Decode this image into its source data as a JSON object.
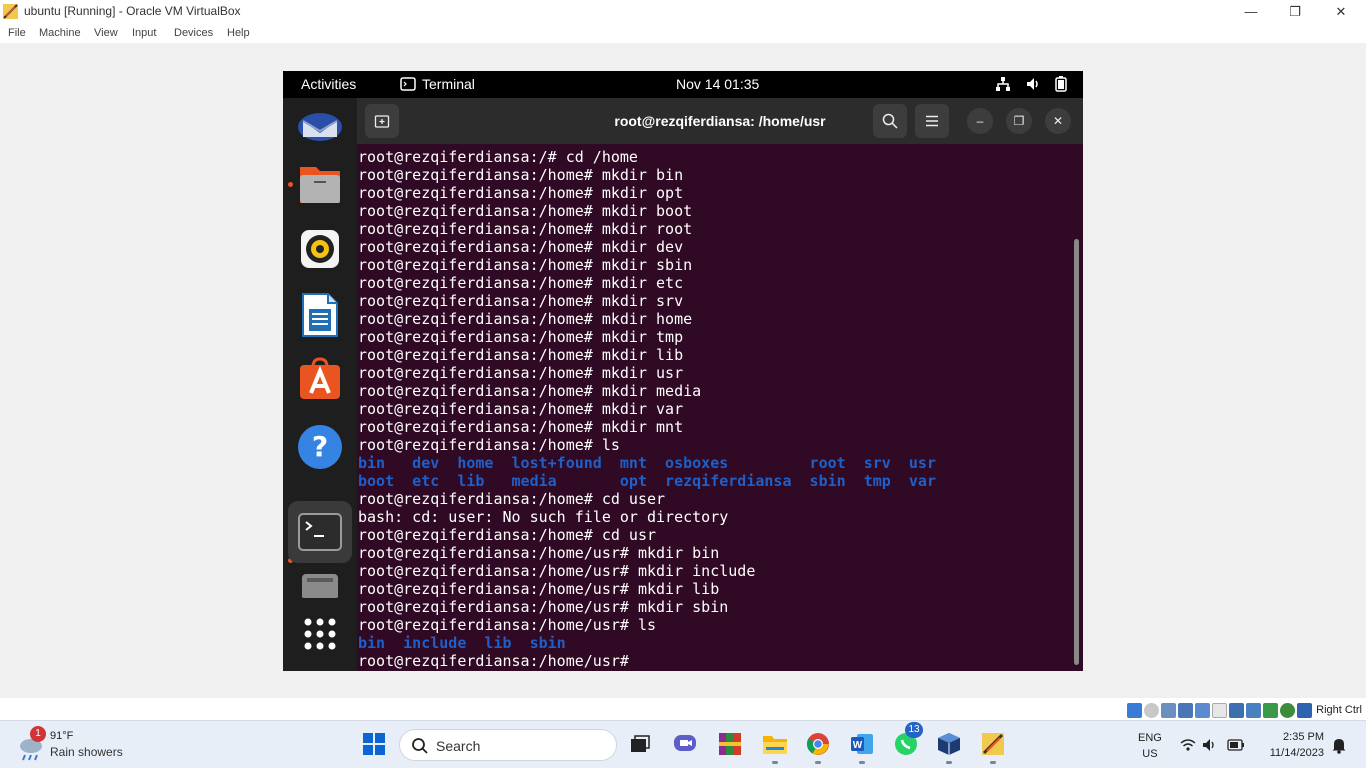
{
  "vbox": {
    "title": "ubuntu [Running] - Oracle VM VirtualBox",
    "menu": [
      "File",
      "Machine",
      "View",
      "Input",
      "Devices",
      "Help"
    ],
    "host_key": "Right Ctrl"
  },
  "gnome": {
    "activities": "Activities",
    "app_name": "Terminal",
    "clock": "Nov 14  01:35"
  },
  "terminal": {
    "title": "root@rezqiferdiansa: /home/usr",
    "lines": [
      {
        "text": "root@rezqiferdiansa:/# cd /home",
        "kind": "cmd"
      },
      {
        "text": "root@rezqiferdiansa:/home# mkdir bin",
        "kind": "cmd"
      },
      {
        "text": "root@rezqiferdiansa:/home# mkdir opt",
        "kind": "cmd"
      },
      {
        "text": "root@rezqiferdiansa:/home# mkdir boot",
        "kind": "cmd"
      },
      {
        "text": "root@rezqiferdiansa:/home# mkdir root",
        "kind": "cmd"
      },
      {
        "text": "root@rezqiferdiansa:/home# mkdir dev",
        "kind": "cmd"
      },
      {
        "text": "root@rezqiferdiansa:/home# mkdir sbin",
        "kind": "cmd"
      },
      {
        "text": "root@rezqiferdiansa:/home# mkdir etc",
        "kind": "cmd"
      },
      {
        "text": "root@rezqiferdiansa:/home# mkdir srv",
        "kind": "cmd"
      },
      {
        "text": "root@rezqiferdiansa:/home# mkdir home",
        "kind": "cmd"
      },
      {
        "text": "root@rezqiferdiansa:/home# mkdir tmp",
        "kind": "cmd"
      },
      {
        "text": "root@rezqiferdiansa:/home# mkdir lib",
        "kind": "cmd"
      },
      {
        "text": "root@rezqiferdiansa:/home# mkdir usr",
        "kind": "cmd"
      },
      {
        "text": "root@rezqiferdiansa:/home# mkdir media",
        "kind": "cmd"
      },
      {
        "text": "root@rezqiferdiansa:/home# mkdir var",
        "kind": "cmd"
      },
      {
        "text": "root@rezqiferdiansa:/home# mkdir mnt",
        "kind": "cmd"
      },
      {
        "text": "root@rezqiferdiansa:/home# ls",
        "kind": "cmd"
      },
      {
        "text": "bin   dev  home  lost+found  mnt  osboxes         root  srv  usr",
        "kind": "ls"
      },
      {
        "text": "boot  etc  lib   media       opt  rezqiferdiansa  sbin  tmp  var",
        "kind": "ls"
      },
      {
        "text": "root@rezqiferdiansa:/home# cd user",
        "kind": "cmd"
      },
      {
        "text": "bash: cd: user: No such file or directory",
        "kind": "out"
      },
      {
        "text": "root@rezqiferdiansa:/home# cd usr",
        "kind": "cmd"
      },
      {
        "text": "root@rezqiferdiansa:/home/usr# mkdir bin",
        "kind": "cmd"
      },
      {
        "text": "root@rezqiferdiansa:/home/usr# mkdir include",
        "kind": "cmd"
      },
      {
        "text": "root@rezqiferdiansa:/home/usr# mkdir lib",
        "kind": "cmd"
      },
      {
        "text": "root@rezqiferdiansa:/home/usr# mkdir sbin",
        "kind": "cmd"
      },
      {
        "text": "root@rezqiferdiansa:/home/usr# ls",
        "kind": "cmd"
      },
      {
        "text": "bin  include  lib  sbin",
        "kind": "ls"
      },
      {
        "text": "root@rezqiferdiansa:/home/usr# ",
        "kind": "cmd"
      }
    ]
  },
  "taskbar": {
    "weather_temp": "91°F",
    "weather_desc": "Rain showers",
    "weather_badge": "1",
    "search_label": "Search",
    "whatsapp_badge": "13",
    "lang_top": "ENG",
    "lang_bottom": "US",
    "time": "2:35 PM",
    "date": "11/14/2023"
  },
  "colors": {
    "terminal_bg": "#300a24",
    "ls_dir_blue": "#1f5fc8",
    "ubuntu_orange": "#e95420"
  }
}
